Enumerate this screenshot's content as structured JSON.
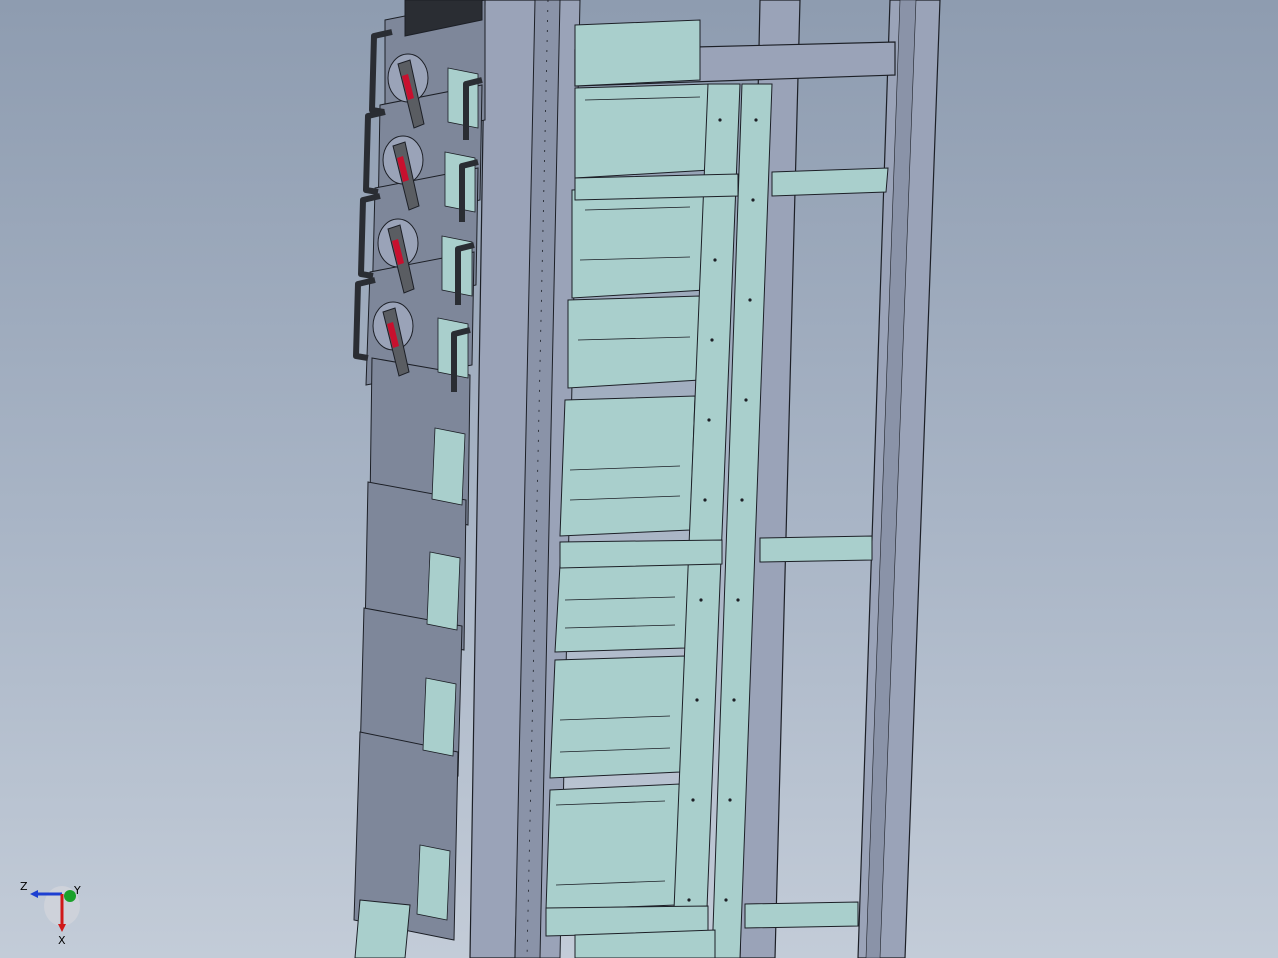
{
  "view": {
    "background_top": "#8e9cb0",
    "background_bottom": "#c3ccd8"
  },
  "model": {
    "colors": {
      "frame": "#9aa3b8",
      "frame_dark": "#5e6678",
      "panel": "#7e879a",
      "drawer": "#a9cfcc",
      "drawer_dark": "#7fa9a6",
      "edge": "#1c1f26",
      "handle": "#2a2d33",
      "switch": "#5a5d62",
      "switch_red": "#c8102e"
    }
  },
  "triad": {
    "labels": {
      "z": "Z",
      "y": "Y",
      "x": "X"
    },
    "colors": {
      "z": "#1d3fd1",
      "y": "#1aa12a",
      "x": "#d01818"
    }
  }
}
